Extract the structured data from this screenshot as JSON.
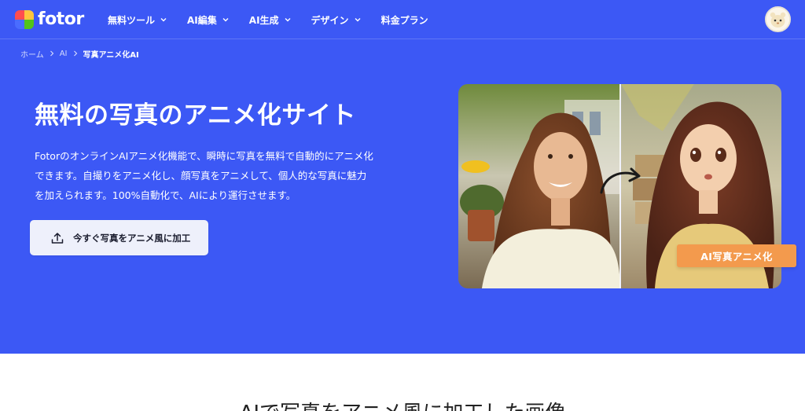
{
  "brand": {
    "name": "fotor",
    "logo_colors": [
      "#ff4d4f",
      "#ffc53d",
      "#52c41a",
      "#4a6cff"
    ]
  },
  "colors": {
    "hero_background": "#3c58f5",
    "badge": "#f39a4d",
    "cta_background": "#eef0fb"
  },
  "nav": {
    "items": [
      {
        "label": "無料ツール",
        "has_dropdown": true
      },
      {
        "label": "AI編集",
        "has_dropdown": true
      },
      {
        "label": "AI生成",
        "has_dropdown": true
      },
      {
        "label": "デザイン",
        "has_dropdown": true
      },
      {
        "label": "料金プラン",
        "has_dropdown": false
      }
    ]
  },
  "breadcrumb": {
    "items": [
      "ホーム",
      "AI",
      "写真アニメ化AI"
    ]
  },
  "hero": {
    "title": "無料の写真のアニメ化サイト",
    "description_lines": [
      "FotorのオンラインAIアニメ化機能で、瞬時に写真を無料で自動的にアニメ化",
      "できます。自撮りをアニメ化し、顔写真をアニメして、個人的な写真に魅力",
      "を加えられます。100%自動化で、AIにより運行させます。"
    ],
    "cta_label": "今すぐ写真をアニメ風に加工",
    "cta_icon": "upload-icon",
    "badge_label": "AI写真アニメ化"
  },
  "section": {
    "title": "AIで写真をアニメ風に加工した画像"
  }
}
